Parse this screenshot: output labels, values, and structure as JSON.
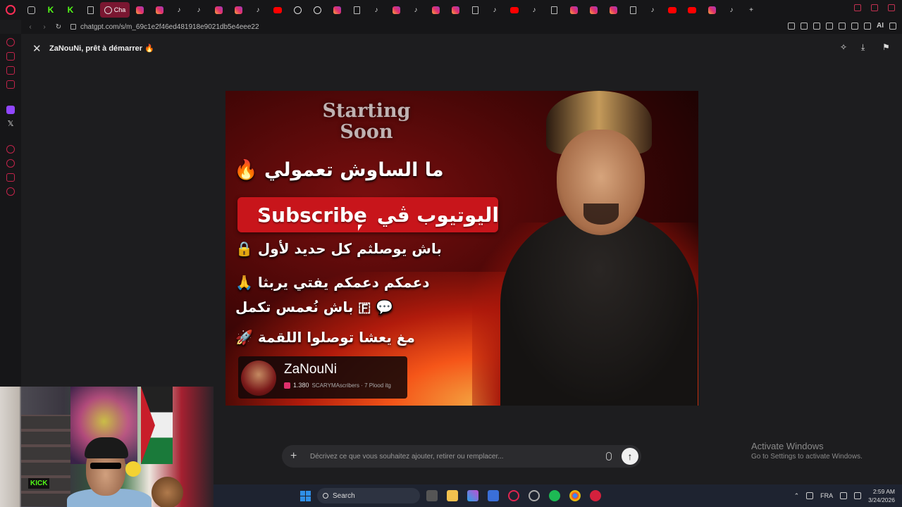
{
  "browser": {
    "active_tab_label": "Cha",
    "url": "chatgpt.com/s/m_69c1e2f46ed481918e9021db5e4eee22",
    "ai_label": "AI"
  },
  "header": {
    "title": "ZaNouNi, prêt à démarrer 🔥"
  },
  "thumbnail": {
    "starting_line1": "Starting",
    "starting_line2": "Soon",
    "line1": "ما الساوش تعمولي 🔥",
    "subscribe_label": "Subscribe",
    "subscribe_suffix": "اليوتيوب ڤي",
    "line3": "باش يوصلثم كل حديد لأول 🔒",
    "line4": "دعمكم دعمكم يفتي يربثا 🙏",
    "line5": "💬 🇫 باش نُعمس تكمل",
    "line6": "مغ يعشا توصلوا اللقمة 🚀",
    "channel": {
      "name": "ZaNouNi",
      "count": "1.380",
      "meta": "SCARYMAscribers · 7 Plood itg"
    }
  },
  "composer": {
    "placeholder": "Décrivez ce que vous souhaitez ajouter, retirer ou remplacer..."
  },
  "watermark": {
    "line1": "Activate Windows",
    "line2": "Go to Settings to activate Windows."
  },
  "taskbar": {
    "search_label": "Search",
    "lang": "FRA",
    "time": "2:59 AM",
    "date": "3/24/2026"
  }
}
